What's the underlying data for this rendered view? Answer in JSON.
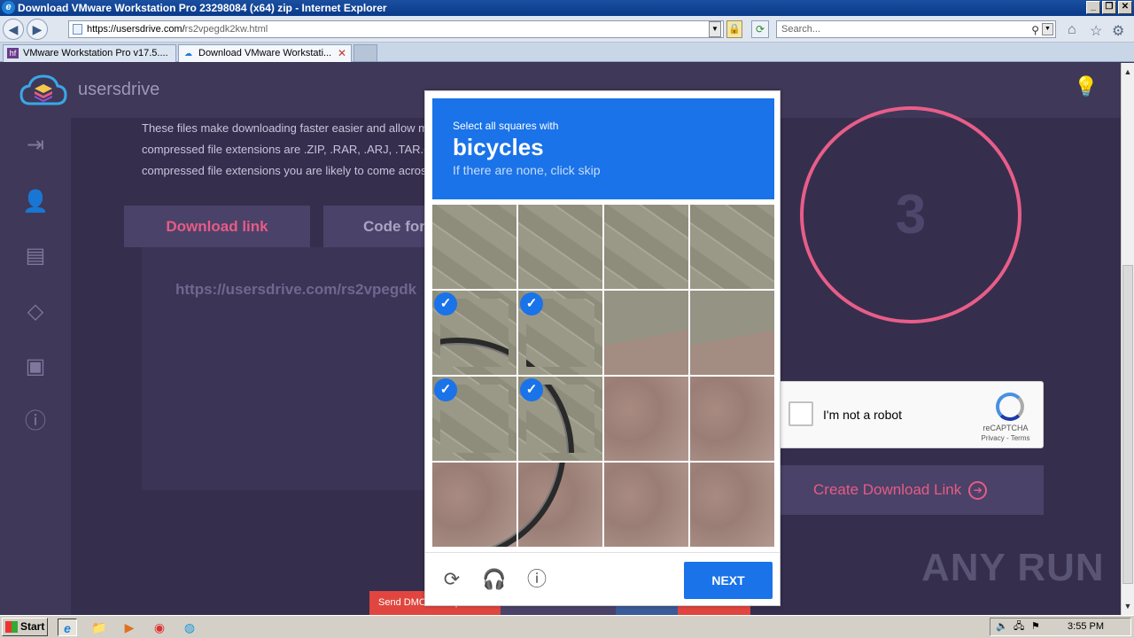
{
  "window": {
    "title": "Download VMware Workstation Pro 23298084 (x64) zip - Internet Explorer",
    "buttons": [
      "_",
      "❐",
      "✕"
    ]
  },
  "addressbar": {
    "url_host": "https://usersdrive.com/",
    "url_path": "rs2vpegdk2kw.html",
    "search_placeholder": "Search..."
  },
  "tabs": [
    {
      "label": "VMware Workstation Pro v17.5....",
      "favicon": "hf",
      "active": false
    },
    {
      "label": "Download VMware Workstati...",
      "favicon": "cloud",
      "active": true
    }
  ],
  "site": {
    "brand": "usersdrive",
    "description": [
      "These files make downloading faster easier and allow m",
      "compressed file extensions are .ZIP, .RAR, .ARJ, .TAR.GZ",
      "compressed file extensions you are likely to come acros"
    ],
    "download_link_label": "Download link",
    "code_label": "Code for",
    "link_text": "https://usersdrive.com/rs2vpegdk",
    "countdown": "3",
    "create_label": "Create Download Link",
    "footer_buttons": [
      "Send DMCA Complaint"
    ],
    "watermark": "ANY RUN"
  },
  "recaptcha_widget": {
    "label": "I'm not a robot",
    "brand": "reCAPTCHA",
    "links": "Privacy - Terms"
  },
  "captcha": {
    "instruction": "Select all squares with",
    "target": "bicycles",
    "hint": "If there are none, click skip",
    "next_label": "NEXT",
    "tiles": [
      {
        "selected": false
      },
      {
        "selected": false
      },
      {
        "selected": false
      },
      {
        "selected": false
      },
      {
        "selected": true
      },
      {
        "selected": true
      },
      {
        "selected": false
      },
      {
        "selected": false
      },
      {
        "selected": true
      },
      {
        "selected": true
      },
      {
        "selected": false
      },
      {
        "selected": false
      },
      {
        "selected": false
      },
      {
        "selected": false
      },
      {
        "selected": false
      },
      {
        "selected": false
      }
    ]
  },
  "taskbar": {
    "start_label": "Start",
    "time": "3:55 PM"
  }
}
